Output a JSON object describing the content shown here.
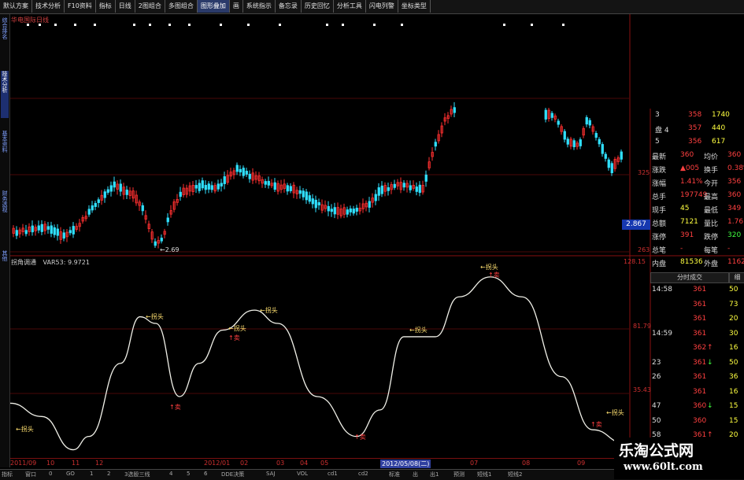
{
  "toolbar": [
    "默认方案",
    "技术分析",
    "F10资料",
    "指标",
    "日线",
    "2图组合",
    "多图组合",
    "图形叠加",
    "画",
    "系统指示",
    "备忘录",
    "历史回忆",
    "分析工具",
    "闪电列警",
    "坐标类型"
  ],
  "toolbar_active": 7,
  "left_tabs": [
    "综合排名",
    "技术分析",
    "基本资料",
    "财务透视",
    "其他"
  ],
  "left_active": 1,
  "stock_title": "华电国际日线",
  "indicator_title": [
    "拐角调通",
    "VAR53: 9.9721"
  ],
  "y_labels": {
    "top1": "325",
    "low": "263",
    "ind_top": "128.15",
    "ind_mid": "81.79",
    "ind_low": "35.43"
  },
  "price_box": "2.867",
  "low_price_label": "2.69",
  "signal_labels": {
    "buy": "拐头",
    "sell": "卖"
  },
  "quote_rows": [
    {
      "k": "3",
      "v1": "358",
      "v2": "1740"
    },
    {
      "k": "盘 4",
      "v1": "357",
      "v2": "440"
    },
    {
      "k": "5",
      "v1": "356",
      "v2": "617"
    }
  ],
  "quote_stats": [
    {
      "l1": "最新",
      "v1": "360",
      "l2": "均价",
      "v2": "360"
    },
    {
      "l1": "涨跌",
      "v1": "▲005",
      "l2": "换手",
      "v2": "0.38%"
    },
    {
      "l1": "涨幅",
      "v1": "1.41%",
      "l2": "今开",
      "v2": "356"
    },
    {
      "l1": "总手",
      "v1": "197749",
      "l2": "最高",
      "v2": "360"
    },
    {
      "l1": "现手",
      "v1": "45",
      "l2": "最低",
      "v2": "349"
    },
    {
      "l1": "总额",
      "v1": "7121",
      "l2": "量比",
      "v2": "1.76"
    },
    {
      "l1": "涨停",
      "v1": "391",
      "l2": "跌停",
      "v2": "320"
    },
    {
      "l1": "总笔",
      "v1": "-",
      "l2": "每笔",
      "v2": "-"
    },
    {
      "l1": "内盘",
      "v1": "81536",
      "l2": "外盘",
      "v2": "116213"
    }
  ],
  "trades_tab": "分时成交",
  "trades_tab2": "细",
  "trades": [
    {
      "t": "14:58",
      "p": "361",
      "a": "",
      "v": "50"
    },
    {
      "t": "",
      "p": "361",
      "a": "",
      "v": "73"
    },
    {
      "t": "",
      "p": "361",
      "a": "",
      "v": "20"
    },
    {
      "t": "14:59",
      "p": "361",
      "a": "",
      "v": "30"
    },
    {
      "t": "",
      "p": "362",
      "a": "↑",
      "v": "16"
    },
    {
      "t": "23",
      "p": "361",
      "a": "↓",
      "v": "50"
    },
    {
      "t": "26",
      "p": "361",
      "a": "",
      "v": "36"
    },
    {
      "t": "",
      "p": "361",
      "a": "",
      "v": "16"
    },
    {
      "t": "47",
      "p": "360",
      "a": "↓",
      "v": "15"
    },
    {
      "t": "50",
      "p": "360",
      "a": "",
      "v": "15"
    },
    {
      "t": "58",
      "p": "361",
      "a": "↑",
      "v": "20"
    },
    {
      "t": "15:00",
      "p": "360",
      "a": "↓",
      "v": "807"
    }
  ],
  "x_labels": [
    "2011/09",
    "10",
    "11",
    "12",
    "2012/01",
    "02",
    "03",
    "04",
    "05",
    "2012/05/08(二)",
    "07",
    "08",
    "09"
  ],
  "x_highlight": 9,
  "bottom_tabs": [
    "指标",
    "窗口",
    "0",
    "GO",
    "1",
    "2",
    "3选股三线",
    "4",
    "5",
    "6",
    "DDE决策",
    "SAJ",
    "VOL",
    "cd1",
    "cd2",
    "标准",
    "出",
    "出1",
    "预测",
    "短线1",
    "短线2"
  ],
  "watermark": {
    "line1": "乐淘公式网",
    "line2": "www.60lt.com"
  },
  "chart_data": {
    "type": "line",
    "title": "",
    "candles_note": "",
    "indicator_series": [
      {
        "x": 0,
        "y": 40
      },
      {
        "x": 40,
        "y": 30
      },
      {
        "x": 80,
        "y": 5
      },
      {
        "x": 100,
        "y": 15
      },
      {
        "x": 140,
        "y": 70
      },
      {
        "x": 165,
        "y": 105
      },
      {
        "x": 185,
        "y": 100
      },
      {
        "x": 215,
        "y": 45
      },
      {
        "x": 240,
        "y": 70
      },
      {
        "x": 270,
        "y": 95
      },
      {
        "x": 310,
        "y": 110
      },
      {
        "x": 340,
        "y": 100
      },
      {
        "x": 390,
        "y": 45
      },
      {
        "x": 440,
        "y": 15
      },
      {
        "x": 470,
        "y": 35
      },
      {
        "x": 500,
        "y": 90
      },
      {
        "x": 540,
        "y": 90
      },
      {
        "x": 570,
        "y": 120
      },
      {
        "x": 610,
        "y": 135
      },
      {
        "x": 650,
        "y": 120
      },
      {
        "x": 700,
        "y": 60
      },
      {
        "x": 740,
        "y": 20
      },
      {
        "x": 780,
        "y": 10
      }
    ],
    "ylim": [
      0,
      145
    ]
  }
}
